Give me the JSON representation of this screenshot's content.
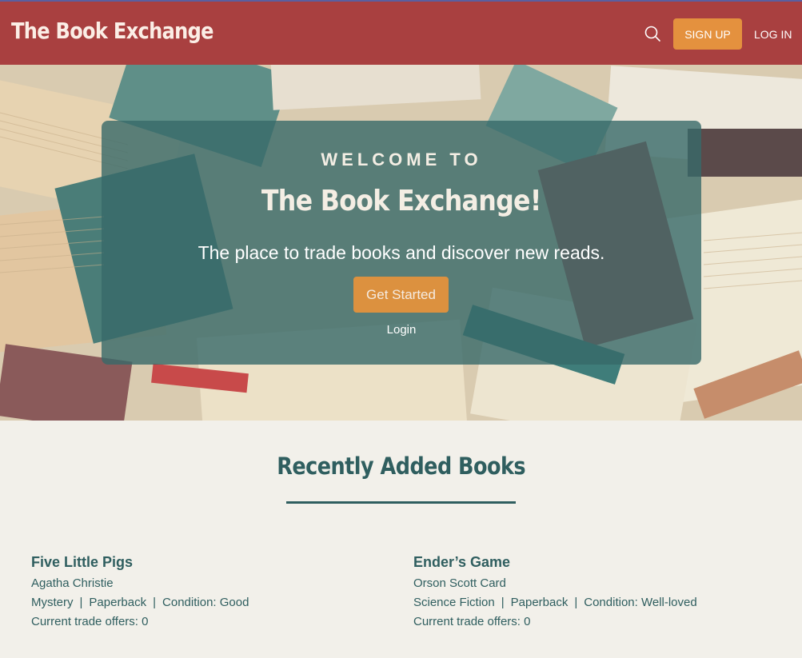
{
  "nav": {
    "brand": "The Book Exchange",
    "signup_label": "SIGN UP",
    "login_label": "LOG IN",
    "search_icon": "search-icon"
  },
  "hero": {
    "welcome": "WELCOME TO",
    "title": "The Book Exchange!",
    "subtitle": "The place to trade books and discover new reads.",
    "cta_label": "Get Started",
    "login_label": "Login"
  },
  "recent": {
    "heading": "Recently Added Books",
    "books": [
      {
        "title": "Five Little Pigs",
        "author": "Agatha Christie",
        "genre": "Mystery",
        "format": "Paperback",
        "condition": "Condition: Good",
        "offers": "Current trade offers: 0"
      },
      {
        "title": "Ender’s Game",
        "author": "Orson Scott Card",
        "genre": "Science Fiction",
        "format": "Paperback",
        "condition": "Condition: Well-loved",
        "offers": "Current trade offers: 0"
      }
    ],
    "separator": "|"
  },
  "colors": {
    "nav_bg": "#a94040",
    "accent": "#e4913e",
    "teal": "#2f5e5f",
    "page_bg": "#f2f0ea"
  }
}
